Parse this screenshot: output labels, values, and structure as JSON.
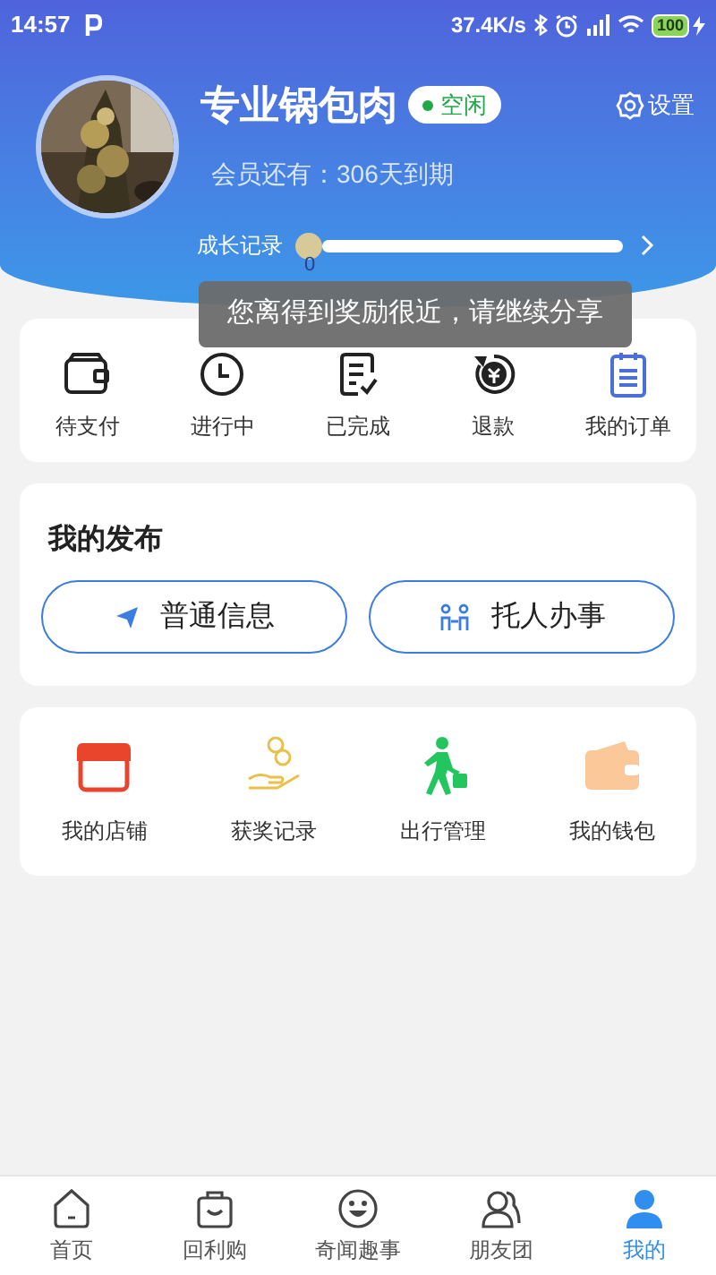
{
  "status_bar": {
    "time": "14:57",
    "speed": "37.4K/s",
    "battery": "100"
  },
  "profile": {
    "name": "专业锅包肉",
    "status": "空闲",
    "member_text": "会员还有：306天到期",
    "settings_label": "设置"
  },
  "growth": {
    "label": "成长记录",
    "level": 0,
    "value": "0"
  },
  "toast": "您离得到奖励很近，请继续分享",
  "orders": [
    {
      "label": "待支付"
    },
    {
      "label": "进行中"
    },
    {
      "label": "已完成"
    },
    {
      "label": "退款"
    },
    {
      "label": "我的订单"
    }
  ],
  "publish": {
    "title": "我的发布",
    "buttons": [
      {
        "label": "普通信息"
      },
      {
        "label": "托人办事"
      }
    ]
  },
  "tools": [
    {
      "label": "我的店铺"
    },
    {
      "label": "获奖记录"
    },
    {
      "label": "出行管理"
    },
    {
      "label": "我的钱包"
    }
  ],
  "tabs": [
    {
      "label": "首页",
      "selected": false
    },
    {
      "label": "回利购",
      "selected": false
    },
    {
      "label": "奇闻趣事",
      "selected": false
    },
    {
      "label": "朋友团",
      "selected": false
    },
    {
      "label": "我的",
      "selected": true
    }
  ]
}
